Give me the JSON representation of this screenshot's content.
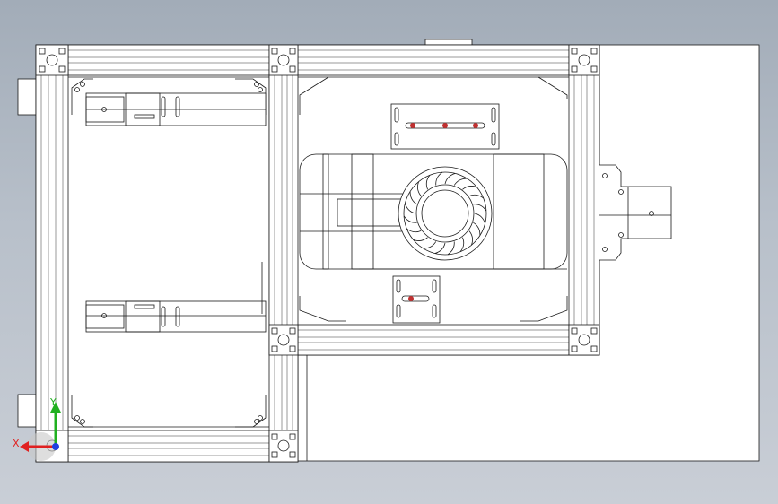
{
  "view": {
    "background_top": "#a2acb8",
    "background_bottom": "#c9ced6",
    "line_color": "#1a1a1a",
    "part_fill": "#ffffff"
  },
  "triad": {
    "x_label": "X",
    "y_label": "Y",
    "x_color": "#e02020",
    "y_color": "#20b020",
    "z_color": "#2040e0"
  }
}
